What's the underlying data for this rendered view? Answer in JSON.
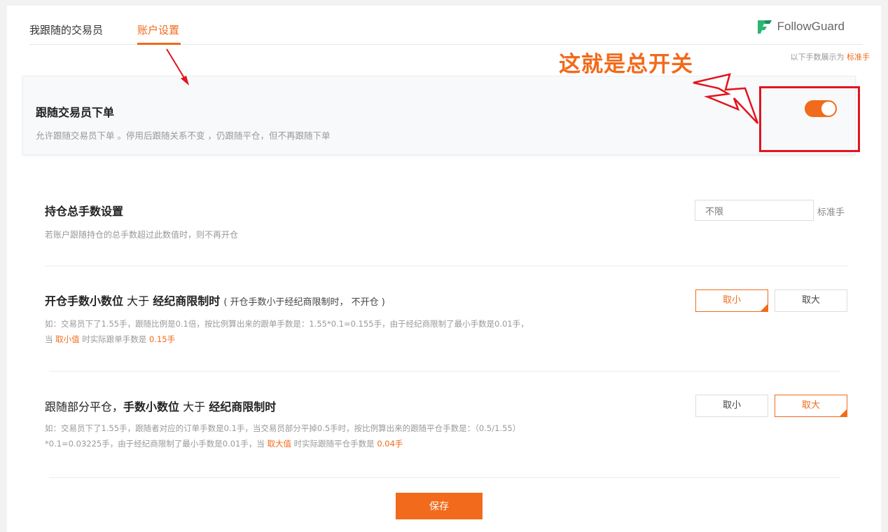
{
  "tabs": [
    {
      "label": "我跟随的交易员"
    },
    {
      "label": "账户设置"
    }
  ],
  "brand": {
    "name": "FollowGuard",
    "accent": "#f26a1b"
  },
  "units_note": {
    "prefix": "以下手数展示为",
    "highlight": "标准手"
  },
  "annotation": {
    "text": "这就是总开关",
    "color": "#e3141f"
  },
  "master_switch": {
    "title": "跟随交易员下单",
    "description": "允许跟随交易员下单 。停用后跟随关系不变 ，仍跟随平仓，但不再跟随下单",
    "enabled": true
  },
  "max_lots": {
    "title": "持仓总手数设置",
    "description": "若账户跟随持仓的总手数超过此数值时，则不再开仓",
    "value": "不限",
    "unit": "标准手"
  },
  "open_rounding": {
    "title_bold1": "开仓手数小数位",
    "title_mid": " 大于 ",
    "title_bold2": "经纪商限制时",
    "title_paren": "( 开仓手数小于经纪商限制时， 不开仓 )",
    "example_line1": "如：交易员下了1.55手，跟随比例是0.1倍，按比例算出来的跟单手数是：1.55*0.1=0.155手，由于经纪商限制了最小手数是0.01手，",
    "example_l2_a": "当 ",
    "example_l2_hl1": "取小值",
    "example_l2_b": " 时实际跟单手数是 ",
    "example_l2_hl2": "0.15手",
    "options": [
      "取小",
      "取大"
    ],
    "selected": "取小"
  },
  "close_rounding": {
    "title_plain": "跟随部分平仓，",
    "title_bold1": "手数小数位",
    "title_mid": " 大于 ",
    "title_bold2": "经纪商限制时",
    "example_line1": "如：交易员下了1.55手，跟随者对应的订单手数是0.1手，当交易员部分平掉0.5手时，按比例算出来的跟随平仓手数是：（0.5/1.55）",
    "example_l2_a": "*0.1=0.03225手，由于经纪商限制了最小手数是0.01手，当 ",
    "example_l2_hl1": "取大值",
    "example_l2_b": " 时实际跟随平仓手数是 ",
    "example_l2_hl2": "0.04手",
    "options": [
      "取小",
      "取大"
    ],
    "selected": "取大"
  },
  "save_label": "保存"
}
